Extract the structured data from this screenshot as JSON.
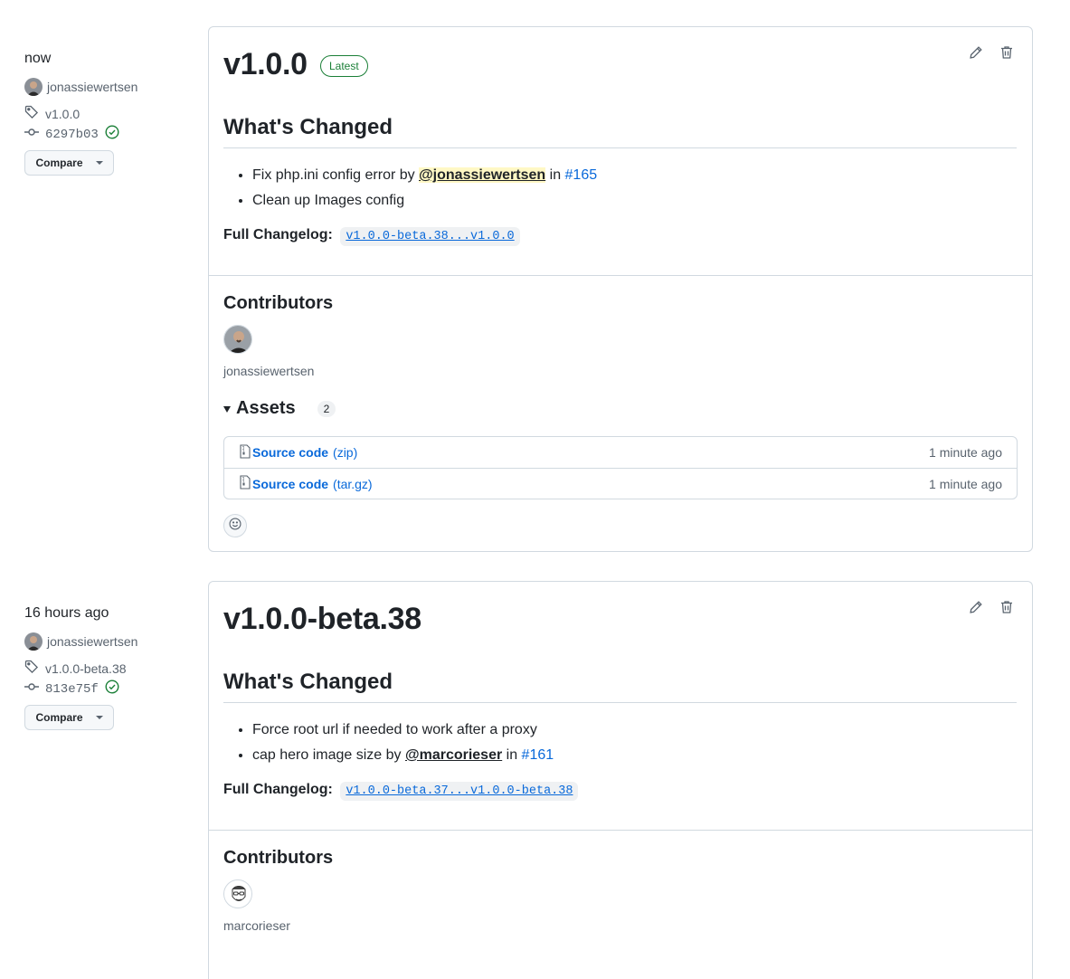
{
  "releases": [
    {
      "meta": {
        "time": "now",
        "author": "jonassiewertsen",
        "tag": "v1.0.0",
        "commit": "6297b03",
        "compare_label": "Compare"
      },
      "title": "v1.0.0",
      "badge": "Latest",
      "whats_changed": "What's Changed",
      "changes": [
        {
          "text": "Fix php.ini config error by ",
          "mention": "@jonassiewertsen",
          "in": " in ",
          "pr": "#165"
        },
        {
          "text": "Clean up Images config"
        }
      ],
      "full_changelog_label": "Full Changelog:",
      "full_changelog_link": "v1.0.0-beta.38...v1.0.0",
      "contributors_heading": "Contributors",
      "contributor": "jonassiewertsen",
      "assets_heading": "Assets",
      "assets_count": "2",
      "assets": [
        {
          "name": "Source code",
          "ext": "(zip)",
          "time": "1 minute ago"
        },
        {
          "name": "Source code",
          "ext": "(tar.gz)",
          "time": "1 minute ago"
        }
      ]
    },
    {
      "meta": {
        "time": "16 hours ago",
        "author": "jonassiewertsen",
        "tag": "v1.0.0-beta.38",
        "commit": "813e75f",
        "compare_label": "Compare"
      },
      "title": "v1.0.0-beta.38",
      "whats_changed": "What's Changed",
      "changes": [
        {
          "text": "Force root url if needed to work after a proxy"
        },
        {
          "text": "cap hero image size by ",
          "mention": "@marcorieser",
          "in": " in ",
          "pr": "#161"
        }
      ],
      "full_changelog_label": "Full Changelog:",
      "full_changelog_link": "v1.0.0-beta.37...v1.0.0-beta.38",
      "contributors_heading": "Contributors",
      "contributor": "marcorieser"
    }
  ],
  "colors": {
    "link": "#0969da",
    "latest_badge": "#1a7f37",
    "check": "#1a7f37",
    "mention_highlight": "#fff8c5"
  }
}
